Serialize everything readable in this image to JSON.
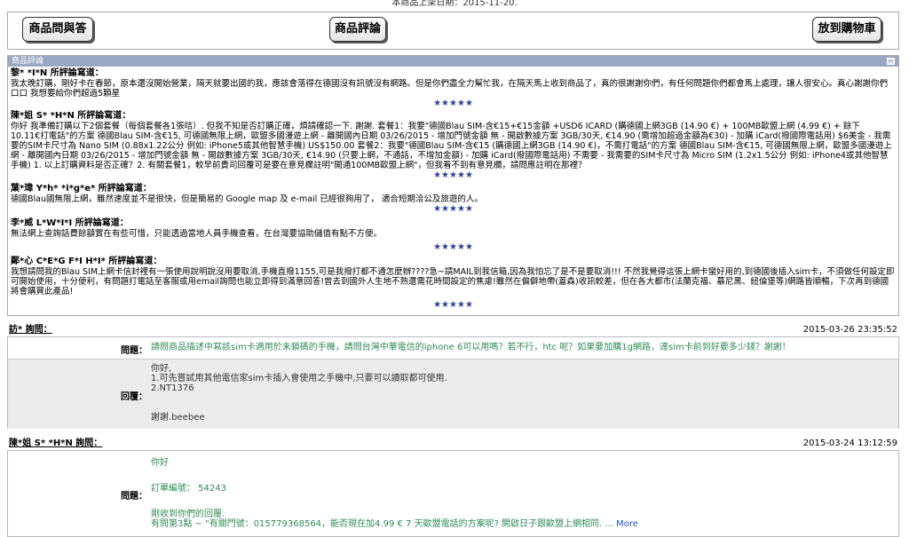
{
  "top_note": "本商品上架日期：2015-11-20.",
  "buttons": {
    "qa": "商品問與答",
    "review": "商品評論",
    "cart": "放到購物車"
  },
  "review_panel": {
    "title": "商品評論",
    "reviews": [
      {
        "author": "黎* *I*N 所評論寫道：",
        "text": "我太晚訂購，剛好卡在春節，原本還沒開始營業，隔天就要出國的我，應該會落得在德國沒有訊號沒有網路。但是你們盡全力幫忙我，在隔天馬上收到商品了，真的很謝謝你們，有任何問題你們都會馬上處理，讓人很安心。真心謝謝你們口口 我想要給你們超過5顆星",
        "stars": "★★★★★"
      },
      {
        "author": "陳*姐 S* *H*N 所評論寫道：",
        "text": "你好 我準備訂購以下2個套餐（每個套餐各1張咭）. 但我不知是否訂購正確，煩請確認一下. 謝謝. 套餐1：我要\"德國Blau SIM-含€15+€15金額 +USD6 ICARD (購德國上網3GB (14.90 €) + 100MB歐盟上網 (4.99 €) + 餘下10.11€打電話\"的方案 德國Blau SIM-含€15, 可德國無限上網，歐盟多國漫遊上網 - 離開國內日期 03/26/2015 - 增加門號金額 無 - 開啟數據方案 3GB/30天, €14.90 (需增加超過金額為€30) - 加購 iCard(撥國際電話用) $6美金 - 我需要的SIM卡尺寸為 Nano SIM (0.88x1.22公分 例如: iPhone5或其他智慧手機) US$150.00 套餐2：我要\"德國Blau SIM-含€15 (購德國上網3GB (14.90 €)，不需打電話\"的方案 德國Blau SIM-含€15, 可德國無限上網，歐盟多國漫遊上網 - 離開國內日期 03/26/2015 - 增加門號金額 無 - 開啟數據方案 3GB/30天, €14.90 (只要上網，不通話，不增加金額) - 加購 iCard(撥國際電話用) 不需要 - 我需要的SIM卡尺寸為 Micro SIM (1.2x1.5公分 例如: iPhone4或其他智慧手機) 1. 以上訂購資料是否正確？2. 有關套餐1，較早前貴司回覆可是要在意見欄註明\"開通100MB歐盟上網\"，但我看不到有意見欄，請問應註明在那裡？",
        "stars": "★★★★★"
      },
      {
        "author": "葉*瑋 Y*h* *i*g*e* 所評論寫道：",
        "text": "德國Blau國無限上網，雖然速度並不是很快，但是簡易的 Google map 及 e-mail 已經很夠用了， 適合短期洽公及旅遊的人。",
        "stars": "★★★★★"
      },
      {
        "author": "李*威 L*W*I*I 所評論寫道：",
        "text": "無法網上查詢話費餘額實在有些可惜，只能透過當地人員手機查看，在台灣要協助儲值有點不方便。",
        "stars": "★★★★★"
      },
      {
        "author": "鄭*心 C*E*G F*I H*I* 所評論寫道：",
        "text": "我想請問我的Blau SIM上網卡信封裡有一張使用說明說沒用要取消,手機直撥1155,可是我撥打都不通怎麼辦????急~請MAIL到我信箱,因為我怕忘了是不是要取消!!! 不然我覺得這張上網卡蠻好用的,到德國後插入sim卡，不須做任何設定即可開始使用，十分便利，有問題打電話至客服或用email詢問也能立即得到滿意回答!曾去到國外人生地不熟還需花時間設定的焦慮!雖然在偏僻地帶(蓋森)收訊較差，但在各大都市(法蘭克福、慕尼黑、紐倫堡等)網路皆順暢，下次再到德國將會購買此產品!",
        "stars": "★★★★★"
      }
    ]
  },
  "questions": [
    {
      "asker": "訪* 詢問：",
      "date": "2015-03-26  23:35:52",
      "question_label": "問題：",
      "question": "請問商品描述中寫該sim卡適用於未鎖碼的手機，請問台灣中華電信的iphone 6可以用嗎？若不行，htc 呢？如果要加購1g網路，達sim卡前到好要多少錢？謝謝！",
      "answer_label": "回覆：",
      "answer_lines": [
        "你好,",
        "1.可先嘗試用其他電信家sim卡插入會使用之手機中,只要可以讀取都可使用.",
        "2.NT1376",
        "",
        "謝謝.beebee"
      ]
    },
    {
      "asker": "陳*姐 S* *H*N 詢問：",
      "date": "2015-03-24  13:12:59",
      "question_label": "問題：",
      "question_lines": [
        "你好",
        "",
        "訂單編號： 54243",
        "",
        "剛收到你們的回覆.",
        "有問第3點 ~ \"有關門號：015779368564，能否現在加4.99 € 7 天歐盟電話的方案呢? 開啟日子跟歐盟上網相同. ..."
      ],
      "more": "More"
    }
  ]
}
